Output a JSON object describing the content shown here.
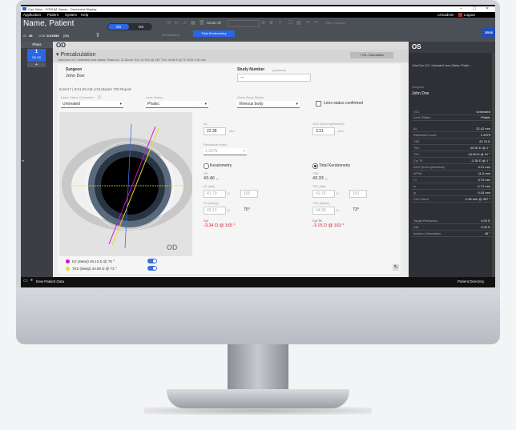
{
  "window": {
    "title": "Carl Zeiss - FORUM Viewer - Document Display",
    "controls": [
      "–",
      "☐",
      "✕"
    ]
  },
  "menu": {
    "items": [
      "Application",
      "Patient",
      "System",
      "Help"
    ],
    "user": "czmadmin",
    "logout": "Logout"
  },
  "patient": {
    "name": "Name, Patient",
    "id_label": "ID",
    "id": "38",
    "dob_label": "DOB",
    "dob": "1/1/1950",
    "age": "(69)"
  },
  "eye_toggle": {
    "od": "OD",
    "os": "OS"
  },
  "toolbar": {
    "close_all": "Close All",
    "view_selector": "Keratometry",
    "active_tab": "Total Keratometry",
    "other_tab": "Keratometry",
    "overlay": "Hide Overlays",
    "brand": "ZEISS"
  },
  "sidebar": {
    "plans_label": "Plans",
    "plan_number": "1",
    "plan_eyes": "OD  OS",
    "add": "+"
  },
  "main": {
    "eye_title": "OD",
    "section_title": "Precalculation",
    "summary": "John Doe  LVC: Untreated  Lens Status: Phakic  AL: 22.38 mm  TK1: 41.76 D @ 163°  TK2: 44.90 D @ 73°  ACD: 3.31 mm",
    "iol_button": "+ IOL Calculation",
    "surgeon_label": "Surgeon",
    "surgeon_value": "John Doe",
    "study_label": "Study Number",
    "study_optional": "(optional)",
    "study_value": "---",
    "exam_info": "5/16/17  |  8:51:29 AM  |  IOLMaster 700 Report",
    "lvc_label": "Laser Vision Correction",
    "lvc_value": "Untreated",
    "lens_label": "Lens Status",
    "lens_value": "Phakic",
    "glass_label": "Glass Body Status",
    "glass_value": "Vitreous body",
    "lens_confirm": "Lens status confirmed",
    "al_label": "AL",
    "al_value": "22.38",
    "mm": "mm",
    "acd_label": "ACD (from epithelium)",
    "acd_value": "3.31",
    "ri_label": "Refractive Index",
    "ri_value": "1.3375",
    "kera_label": "Keratometry",
    "total_kera_label": "Total Keratometry",
    "se_label": "SE",
    "se_value": "43.46",
    "tse_label": "TSE",
    "tse_value": "43.33",
    "d": "D",
    "k1_label": "K1 (flat)",
    "k1_value": "41.79",
    "k1_axis": "165",
    "tk1_label": "TK1 (flat)",
    "tk1_value": "41.76",
    "tk1_axis": "163",
    "k2_label": "K2 (steep)",
    "k2_value": "45.13",
    "k2_axis": "75°",
    "tk2_label": "TK2 (steep)",
    "tk2_value": "44.90",
    "tk2_axis": "73°",
    "cyl_label": "Cyl",
    "cyl_value": "-3.34 D @ 165 °",
    "tcyl_label": "Cyl TK",
    "tcyl_value": "-3.15 D @ 163 °",
    "legend1": "K2  (steep)  45.13  D  @ 75  °",
    "legend2": "TK2  (steep)  44.90  D  @ 73  °",
    "image_eye": "OD"
  },
  "right": {
    "title": "OS",
    "summary": "John Doe  LVC: Untreated  Lens Status: Phakic ...",
    "surgeon_label": "Surgeon",
    "surgeon_value": "John Doe",
    "rows": [
      {
        "k": "LVC",
        "v": "Untreated"
      },
      {
        "k": "Lens Status",
        "v": "Phakic"
      },
      {
        "k": "AL",
        "v": "22.42 mm"
      },
      {
        "k": "Refractive Index",
        "v": "1.3375"
      },
      {
        "k": "TSE",
        "v": "43.78 D"
      },
      {
        "k": "TK1",
        "v": "42.60 D @   1 °"
      },
      {
        "k": "TK2",
        "v": "44.96 D @  91 °"
      },
      {
        "k": "Cyl TK",
        "v": "-2.35 D @   1 °"
      },
      {
        "k": "ACD (from epithelium)",
        "v": "3.21 mm"
      },
      {
        "k": "WTW",
        "v": "11.9 mm"
      },
      {
        "k": "LT",
        "v": "3.70 mm"
      },
      {
        "k": "Ix",
        "v": "-0.71 mm"
      },
      {
        "k": "Iy",
        "v": "0.43 mm"
      },
      {
        "k": "CW-Chord",
        "v": "0.38 mm @ 357 °"
      }
    ],
    "rows2": [
      {
        "k": "Target Refraction",
        "v": "0.00 D"
      },
      {
        "k": "SIA",
        "v": "0.00 D"
      },
      {
        "k": "Incision Orientation",
        "v": "45 °"
      }
    ]
  },
  "taskbar": {
    "new_patient": "New Patient Data",
    "directory": "Patient Directory"
  },
  "colors": {
    "accent": "#2a66e8",
    "header": "#4b4f56",
    "magenta": "#d60fd6",
    "yellow": "#e5dd25"
  }
}
